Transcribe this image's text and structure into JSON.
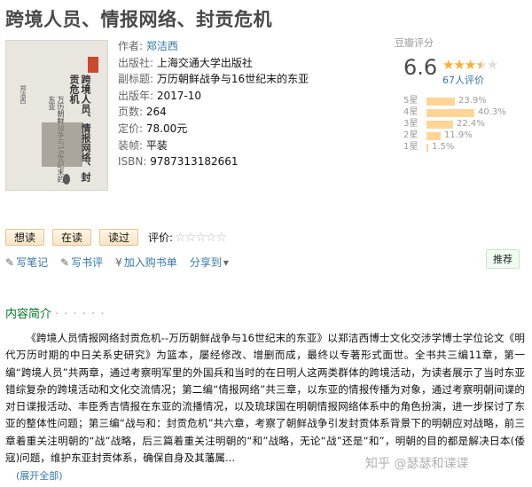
{
  "book": {
    "title": "跨境人员、情报网络、封贡危机",
    "cover_title": "跨境人员、情报网络、封贡危机",
    "cover_subtitle": "万历朝鲜战争与16世纪末的东亚",
    "cover_author": "郑洁西"
  },
  "info": {
    "author_label": "作者:",
    "author": "郑洁西",
    "publisher_label": "出版社:",
    "publisher": "上海交通大学出版社",
    "subtitle_label": "副标题:",
    "subtitle": "万历朝鲜战争与16世纪末的东亚",
    "year_label": "出版年:",
    "year": "2017-10",
    "pages_label": "页数:",
    "pages": "264",
    "price_label": "定价:",
    "price": "78.00元",
    "binding_label": "装帧:",
    "binding": "平装",
    "isbn_label": "ISBN:",
    "isbn": "9787313182661"
  },
  "rating": {
    "label": "豆瓣评分",
    "score": "6.6",
    "stars_filled": 3.5,
    "count": "67人评价",
    "distribution": [
      {
        "label": "5星",
        "percent": 23.9,
        "text": "23.9%"
      },
      {
        "label": "4星",
        "percent": 40.3,
        "text": "40.3%"
      },
      {
        "label": "3星",
        "percent": 22.4,
        "text": "22.4%"
      },
      {
        "label": "2星",
        "percent": 11.9,
        "text": "11.9%"
      },
      {
        "label": "1星",
        "percent": 1.5,
        "text": "1.5%"
      }
    ],
    "bar_color": "#ffd596",
    "star_color": "#ffac2d"
  },
  "buttons": {
    "want": "想读",
    "reading": "在读",
    "read": "读过",
    "evaluate": "评价:"
  },
  "actions": {
    "note": "写笔记",
    "review": "写书评",
    "cart": "加入购书单",
    "share": "分享到",
    "recommend": "推荐"
  },
  "section": {
    "title": "内容简介",
    "dots": "· · · · · ·"
  },
  "intro": "《跨境人员情报网络封贡危机--万历朝鲜战争与16世纪末的东亚》以郑洁西博士文化交涉学博士学位论文《明代万历时期的中日关系史研究》为篮本，屡经修改、增删而成，最终以专著形式面世。全书共三编11章，第一编“跨境人员”共两章，通过考察明军里的外国兵和当时的在日明人这两类群体的跨境活动，为读者展示了当时东亚错综复杂的跨境活动和文化交流情况；第二编“情报网络”共三章，以东亚的情报传播为对象，通过考察明朝间谍的对日谍报活动、丰臣秀吉情报在东亚的流播情况，以及琉球国在明朝情报网络体系中的角色扮演，进一步探讨了东亚的整体性问题；第三编“战与和：封贡危机”共六章，考察了朝鲜战争引发封贡体系背景下的明朝应对战略，前三章着重关注明朝的“战”战略，后三篇着重关注明朝的“和”战略，无论“战”还是“和”，明朝的目的都是解决日本(倭寇)问题，维护东亚封贡体系，确保自身及其藩属...",
  "more": "(展开全部)",
  "watermark": "知乎 @瑟瑟和谍谍"
}
